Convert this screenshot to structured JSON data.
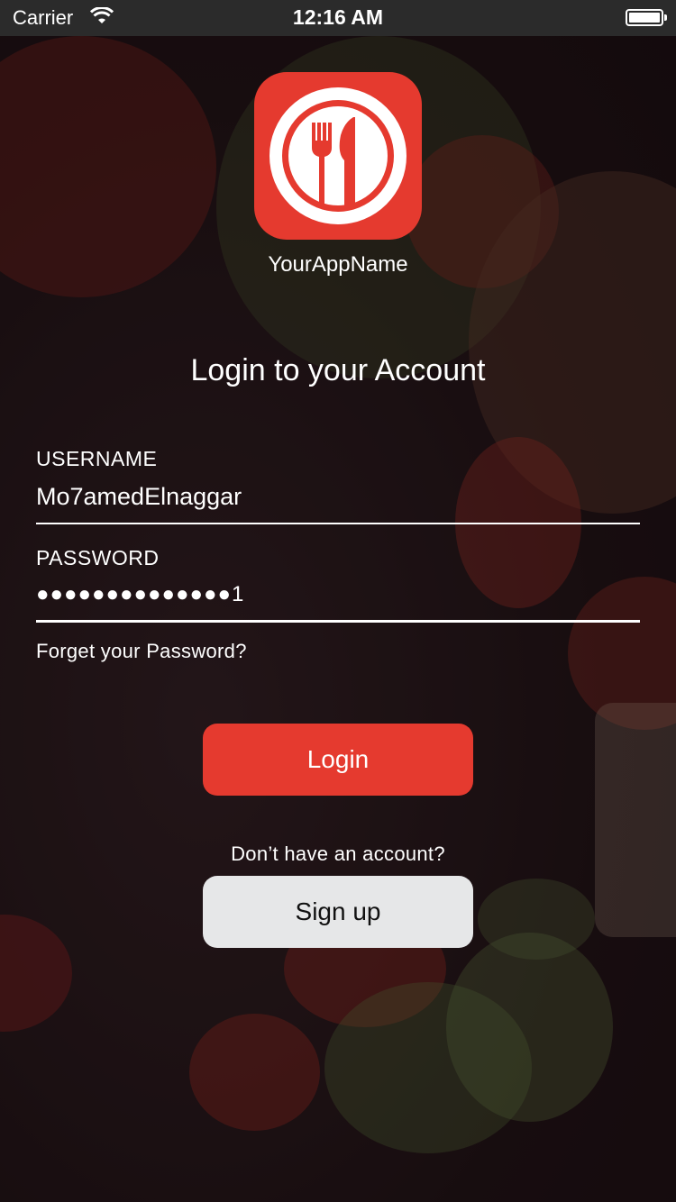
{
  "status_bar": {
    "carrier": "Carrier",
    "time": "12:16 AM",
    "icons": [
      "wifi-icon",
      "battery-icon"
    ]
  },
  "app": {
    "name": "YourAppName",
    "logo_icon": "fork-knife-plate-icon",
    "brand_color": "#e53a2f"
  },
  "login": {
    "heading": "Login to your Account",
    "username_label": "USERNAME",
    "username_value": "Mo7amedElnaggar",
    "password_label": "PASSWORD",
    "password_value": "●●●●●●●●●●●●●●1",
    "forgot_link": "Forget your Password?",
    "login_button": "Login",
    "no_account_text": "Don’t have an account?",
    "signup_button": "Sign up"
  },
  "colors": {
    "accent": "#e53a2f",
    "secondary_button": "#e6e7e8",
    "text": "#ffffff"
  }
}
